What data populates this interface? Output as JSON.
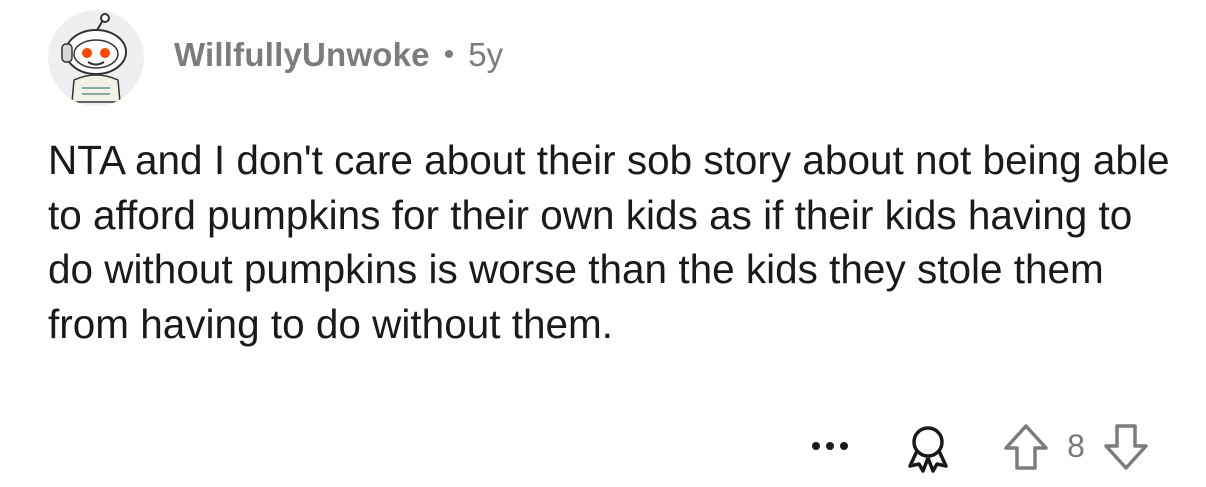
{
  "comment": {
    "author": "WillfullyUnwoke",
    "separator": "•",
    "age": "5y",
    "text": "NTA and I don't care about their sob story about not being able to afford pumpkins for their own kids as if their kids having to do without pumpkins is worse than the kids they stole them from having to do without them."
  },
  "actions": {
    "more_label": "•••",
    "score": "8"
  },
  "colors": {
    "text": "#1a1a1b",
    "muted": "#7c7c7c",
    "avatar_bg": "#edeff1",
    "accent": "#ff4500"
  },
  "icons": {
    "avatar": "snoo-avatar-icon",
    "more": "more-options-icon",
    "award": "award-icon",
    "upvote": "upvote-arrow-icon",
    "downvote": "downvote-arrow-icon"
  }
}
